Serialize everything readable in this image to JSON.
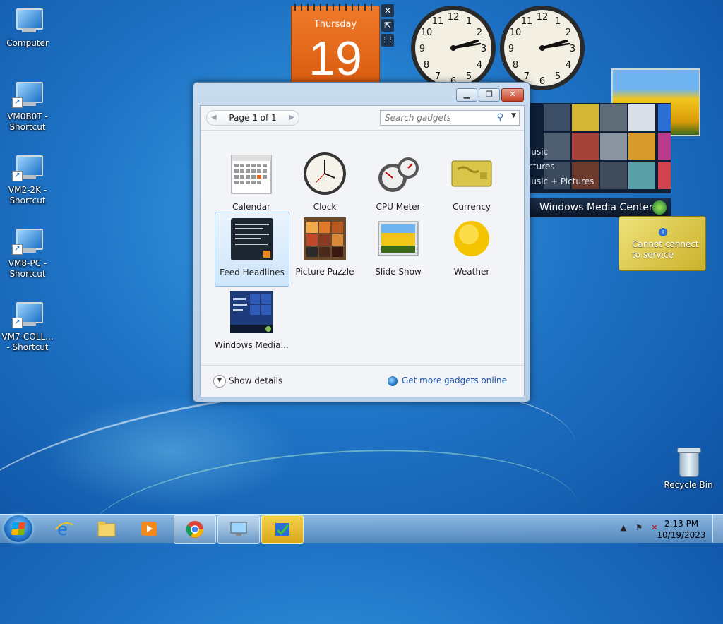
{
  "desktop": {
    "icons": [
      {
        "label": "Computer"
      },
      {
        "label": "VM0B0T -\nShortcut"
      },
      {
        "label": "VM2-2K -\nShortcut"
      },
      {
        "label": "VM8-PC -\nShortcut"
      },
      {
        "label": "VM7-COLL...\n- Shortcut"
      },
      {
        "label": "Recycle Bin"
      }
    ]
  },
  "gadgets": {
    "calendar": {
      "day": "Thursday",
      "date": "19"
    },
    "media_center": {
      "items": [
        "Music",
        "Pictures",
        "Music + Pictures"
      ],
      "brand": "Windows Media Center"
    },
    "currency": {
      "message_line1": "Cannot connect",
      "message_line2": "to service"
    }
  },
  "gallery": {
    "pager_label": "Page 1 of 1",
    "search_placeholder": "Search gadgets",
    "items": [
      {
        "name": "Calendar",
        "icon": "calendar-icon"
      },
      {
        "name": "Clock",
        "icon": "clock-icon"
      },
      {
        "name": "CPU Meter",
        "icon": "cpu-meter-icon"
      },
      {
        "name": "Currency",
        "icon": "currency-icon"
      },
      {
        "name": "Feed Headlines",
        "icon": "feed-headlines-icon",
        "selected": true
      },
      {
        "name": "Picture Puzzle",
        "icon": "picture-puzzle-icon"
      },
      {
        "name": "Slide Show",
        "icon": "slide-show-icon"
      },
      {
        "name": "Weather",
        "icon": "weather-icon"
      },
      {
        "name": "Windows Media...",
        "icon": "media-center-icon"
      }
    ],
    "show_details": "Show details",
    "get_more": "Get more gadgets online"
  },
  "taskbar": {
    "time": "2:13 PM",
    "date": "10/19/2023"
  },
  "colors": {
    "accent": "#1f74c6",
    "calendar_orange": "#e5651a",
    "link_blue": "#1e56a8"
  }
}
